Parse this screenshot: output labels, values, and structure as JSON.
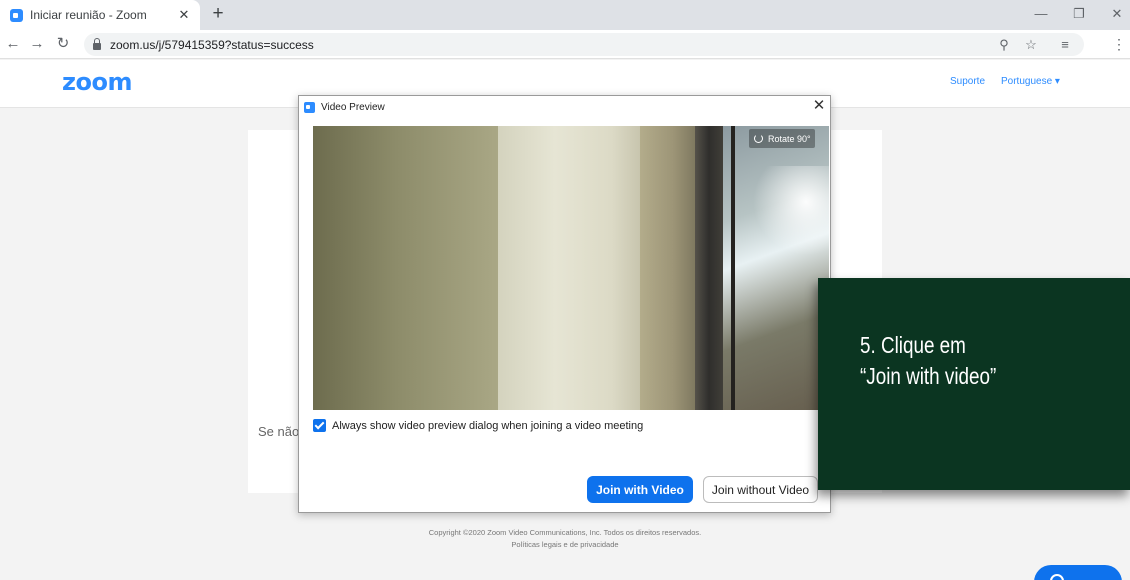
{
  "browser": {
    "tab_title": "Iniciar reunião - Zoom",
    "tab_close": "✕",
    "new_tab": "+",
    "url": "zoom.us/j/579415359?status=success",
    "window_controls": [
      "—",
      "❐",
      "✕"
    ]
  },
  "header": {
    "logo": "zoom",
    "support_link": "Suporte",
    "language_link": "Portuguese ▾"
  },
  "card": {
    "text": "Se não"
  },
  "footer": {
    "line1": "Copyright ©2020 Zoom Video Communications, Inc. Todos os direitos reservados.",
    "line2": "Políticas legais e de privacidade"
  },
  "dialog": {
    "title": "Video Preview",
    "close": "✕",
    "rotate_label": "Rotate 90°",
    "checkbox_label": "Always show video preview dialog when joining a video meeting",
    "checkbox_checked": true,
    "join_with_video": "Join with Video",
    "join_without_video": "Join without Video"
  },
  "callout": {
    "line1": "5. Clique em",
    "line2": "“Join with video”",
    "background": "#0b3521"
  },
  "colors": {
    "zoom_blue": "#2d8cff",
    "button_blue": "#0e72ed"
  }
}
